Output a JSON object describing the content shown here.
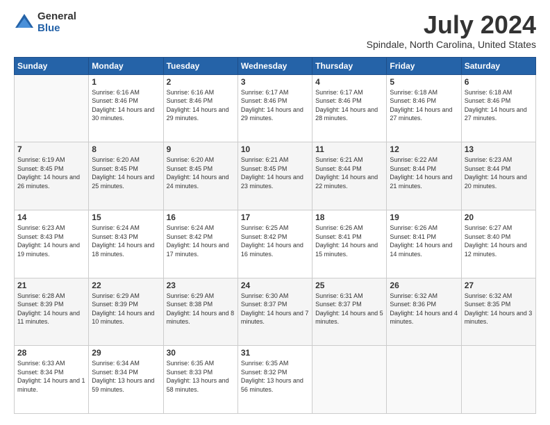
{
  "logo": {
    "general": "General",
    "blue": "Blue"
  },
  "title": "July 2024",
  "subtitle": "Spindale, North Carolina, United States",
  "days": [
    "Sunday",
    "Monday",
    "Tuesday",
    "Wednesday",
    "Thursday",
    "Friday",
    "Saturday"
  ],
  "weeks": [
    [
      {
        "day": "",
        "sunrise": "",
        "sunset": "",
        "daylight": ""
      },
      {
        "day": "1",
        "sunrise": "Sunrise: 6:16 AM",
        "sunset": "Sunset: 8:46 PM",
        "daylight": "Daylight: 14 hours and 30 minutes."
      },
      {
        "day": "2",
        "sunrise": "Sunrise: 6:16 AM",
        "sunset": "Sunset: 8:46 PM",
        "daylight": "Daylight: 14 hours and 29 minutes."
      },
      {
        "day": "3",
        "sunrise": "Sunrise: 6:17 AM",
        "sunset": "Sunset: 8:46 PM",
        "daylight": "Daylight: 14 hours and 29 minutes."
      },
      {
        "day": "4",
        "sunrise": "Sunrise: 6:17 AM",
        "sunset": "Sunset: 8:46 PM",
        "daylight": "Daylight: 14 hours and 28 minutes."
      },
      {
        "day": "5",
        "sunrise": "Sunrise: 6:18 AM",
        "sunset": "Sunset: 8:46 PM",
        "daylight": "Daylight: 14 hours and 27 minutes."
      },
      {
        "day": "6",
        "sunrise": "Sunrise: 6:18 AM",
        "sunset": "Sunset: 8:46 PM",
        "daylight": "Daylight: 14 hours and 27 minutes."
      }
    ],
    [
      {
        "day": "7",
        "sunrise": "Sunrise: 6:19 AM",
        "sunset": "Sunset: 8:45 PM",
        "daylight": "Daylight: 14 hours and 26 minutes."
      },
      {
        "day": "8",
        "sunrise": "Sunrise: 6:20 AM",
        "sunset": "Sunset: 8:45 PM",
        "daylight": "Daylight: 14 hours and 25 minutes."
      },
      {
        "day": "9",
        "sunrise": "Sunrise: 6:20 AM",
        "sunset": "Sunset: 8:45 PM",
        "daylight": "Daylight: 14 hours and 24 minutes."
      },
      {
        "day": "10",
        "sunrise": "Sunrise: 6:21 AM",
        "sunset": "Sunset: 8:45 PM",
        "daylight": "Daylight: 14 hours and 23 minutes."
      },
      {
        "day": "11",
        "sunrise": "Sunrise: 6:21 AM",
        "sunset": "Sunset: 8:44 PM",
        "daylight": "Daylight: 14 hours and 22 minutes."
      },
      {
        "day": "12",
        "sunrise": "Sunrise: 6:22 AM",
        "sunset": "Sunset: 8:44 PM",
        "daylight": "Daylight: 14 hours and 21 minutes."
      },
      {
        "day": "13",
        "sunrise": "Sunrise: 6:23 AM",
        "sunset": "Sunset: 8:44 PM",
        "daylight": "Daylight: 14 hours and 20 minutes."
      }
    ],
    [
      {
        "day": "14",
        "sunrise": "Sunrise: 6:23 AM",
        "sunset": "Sunset: 8:43 PM",
        "daylight": "Daylight: 14 hours and 19 minutes."
      },
      {
        "day": "15",
        "sunrise": "Sunrise: 6:24 AM",
        "sunset": "Sunset: 8:43 PM",
        "daylight": "Daylight: 14 hours and 18 minutes."
      },
      {
        "day": "16",
        "sunrise": "Sunrise: 6:24 AM",
        "sunset": "Sunset: 8:42 PM",
        "daylight": "Daylight: 14 hours and 17 minutes."
      },
      {
        "day": "17",
        "sunrise": "Sunrise: 6:25 AM",
        "sunset": "Sunset: 8:42 PM",
        "daylight": "Daylight: 14 hours and 16 minutes."
      },
      {
        "day": "18",
        "sunrise": "Sunrise: 6:26 AM",
        "sunset": "Sunset: 8:41 PM",
        "daylight": "Daylight: 14 hours and 15 minutes."
      },
      {
        "day": "19",
        "sunrise": "Sunrise: 6:26 AM",
        "sunset": "Sunset: 8:41 PM",
        "daylight": "Daylight: 14 hours and 14 minutes."
      },
      {
        "day": "20",
        "sunrise": "Sunrise: 6:27 AM",
        "sunset": "Sunset: 8:40 PM",
        "daylight": "Daylight: 14 hours and 12 minutes."
      }
    ],
    [
      {
        "day": "21",
        "sunrise": "Sunrise: 6:28 AM",
        "sunset": "Sunset: 8:39 PM",
        "daylight": "Daylight: 14 hours and 11 minutes."
      },
      {
        "day": "22",
        "sunrise": "Sunrise: 6:29 AM",
        "sunset": "Sunset: 8:39 PM",
        "daylight": "Daylight: 14 hours and 10 minutes."
      },
      {
        "day": "23",
        "sunrise": "Sunrise: 6:29 AM",
        "sunset": "Sunset: 8:38 PM",
        "daylight": "Daylight: 14 hours and 8 minutes."
      },
      {
        "day": "24",
        "sunrise": "Sunrise: 6:30 AM",
        "sunset": "Sunset: 8:37 PM",
        "daylight": "Daylight: 14 hours and 7 minutes."
      },
      {
        "day": "25",
        "sunrise": "Sunrise: 6:31 AM",
        "sunset": "Sunset: 8:37 PM",
        "daylight": "Daylight: 14 hours and 5 minutes."
      },
      {
        "day": "26",
        "sunrise": "Sunrise: 6:32 AM",
        "sunset": "Sunset: 8:36 PM",
        "daylight": "Daylight: 14 hours and 4 minutes."
      },
      {
        "day": "27",
        "sunrise": "Sunrise: 6:32 AM",
        "sunset": "Sunset: 8:35 PM",
        "daylight": "Daylight: 14 hours and 3 minutes."
      }
    ],
    [
      {
        "day": "28",
        "sunrise": "Sunrise: 6:33 AM",
        "sunset": "Sunset: 8:34 PM",
        "daylight": "Daylight: 14 hours and 1 minute."
      },
      {
        "day": "29",
        "sunrise": "Sunrise: 6:34 AM",
        "sunset": "Sunset: 8:34 PM",
        "daylight": "Daylight: 13 hours and 59 minutes."
      },
      {
        "day": "30",
        "sunrise": "Sunrise: 6:35 AM",
        "sunset": "Sunset: 8:33 PM",
        "daylight": "Daylight: 13 hours and 58 minutes."
      },
      {
        "day": "31",
        "sunrise": "Sunrise: 6:35 AM",
        "sunset": "Sunset: 8:32 PM",
        "daylight": "Daylight: 13 hours and 56 minutes."
      },
      {
        "day": "",
        "sunrise": "",
        "sunset": "",
        "daylight": ""
      },
      {
        "day": "",
        "sunrise": "",
        "sunset": "",
        "daylight": ""
      },
      {
        "day": "",
        "sunrise": "",
        "sunset": "",
        "daylight": ""
      }
    ]
  ]
}
